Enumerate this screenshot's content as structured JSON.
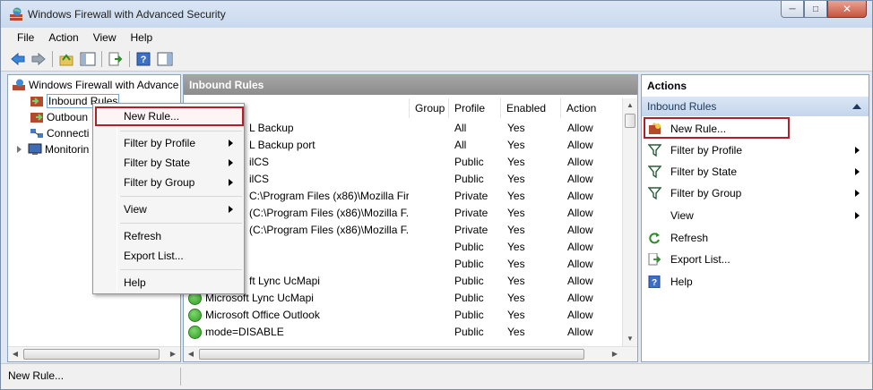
{
  "window": {
    "title": "Windows Firewall with Advanced Security"
  },
  "menubar": {
    "items": [
      "File",
      "Action",
      "View",
      "Help"
    ]
  },
  "tree": {
    "items": [
      {
        "label": "Windows Firewall with Advance",
        "icon": "firewall-icon"
      },
      {
        "label": "Inbound Rules",
        "icon": "inbound-rules-icon",
        "selected": true
      },
      {
        "label": "Outboun",
        "icon": "outbound-rules-icon"
      },
      {
        "label": "Connecti",
        "icon": "connection-security-icon"
      },
      {
        "label": "Monitorin",
        "icon": "monitoring-icon"
      }
    ]
  },
  "center": {
    "title": "Inbound Rules",
    "columns": [
      "Group",
      "Profile",
      "Enabled",
      "Action"
    ],
    "rows": [
      {
        "name": "L Backup",
        "group": "",
        "profile": "All",
        "enabled": "Yes",
        "action": "Allow",
        "icon": false
      },
      {
        "name": "L Backup port",
        "group": "",
        "profile": "All",
        "enabled": "Yes",
        "action": "Allow",
        "icon": false
      },
      {
        "name": "ilCS",
        "group": "",
        "profile": "Public",
        "enabled": "Yes",
        "action": "Allow",
        "icon": false
      },
      {
        "name": "ilCS",
        "group": "",
        "profile": "Public",
        "enabled": "Yes",
        "action": "Allow",
        "icon": false
      },
      {
        "name": "C:\\Program Files (x86)\\Mozilla Fir...",
        "group": "",
        "profile": "Private",
        "enabled": "Yes",
        "action": "Allow",
        "icon": false
      },
      {
        "name": "(C:\\Program Files (x86)\\Mozilla F...",
        "group": "",
        "profile": "Private",
        "enabled": "Yes",
        "action": "Allow",
        "icon": false
      },
      {
        "name": "(C:\\Program Files (x86)\\Mozilla F...",
        "group": "",
        "profile": "Private",
        "enabled": "Yes",
        "action": "Allow",
        "icon": false
      },
      {
        "name": "",
        "group": "",
        "profile": "Public",
        "enabled": "Yes",
        "action": "Allow",
        "icon": false
      },
      {
        "name": "",
        "group": "",
        "profile": "Public",
        "enabled": "Yes",
        "action": "Allow",
        "icon": false
      },
      {
        "name": "ft Lync UcMapi",
        "group": "",
        "profile": "Public",
        "enabled": "Yes",
        "action": "Allow",
        "icon": false
      },
      {
        "name": "Microsoft Lync UcMapi",
        "group": "",
        "profile": "Public",
        "enabled": "Yes",
        "action": "Allow",
        "icon": true
      },
      {
        "name": "Microsoft Office Outlook",
        "group": "",
        "profile": "Public",
        "enabled": "Yes",
        "action": "Allow",
        "icon": true
      },
      {
        "name": "mode=DISABLE",
        "group": "",
        "profile": "Public",
        "enabled": "Yes",
        "action": "Allow",
        "icon": true
      }
    ]
  },
  "actions": {
    "title": "Actions",
    "section": "Inbound Rules",
    "items": [
      {
        "label": "New Rule...",
        "icon": "new-rule-icon",
        "submenu": false
      },
      {
        "label": "Filter by Profile",
        "icon": "filter-icon",
        "submenu": true
      },
      {
        "label": "Filter by State",
        "icon": "filter-icon",
        "submenu": true
      },
      {
        "label": "Filter by Group",
        "icon": "filter-icon",
        "submenu": true
      },
      {
        "label": "View",
        "icon": "",
        "submenu": true
      },
      {
        "label": "Refresh",
        "icon": "refresh-icon",
        "submenu": false
      },
      {
        "label": "Export List...",
        "icon": "export-icon",
        "submenu": false
      },
      {
        "label": "Help",
        "icon": "help-icon",
        "submenu": false
      }
    ]
  },
  "context_menu": {
    "items": [
      {
        "label": "New Rule...",
        "submenu": false
      },
      {
        "label": "Filter by Profile",
        "submenu": true
      },
      {
        "label": "Filter by State",
        "submenu": true
      },
      {
        "label": "Filter by Group",
        "submenu": true
      },
      {
        "label": "View",
        "submenu": true
      },
      {
        "label": "Refresh",
        "submenu": false
      },
      {
        "label": "Export List...",
        "submenu": false
      },
      {
        "label": "Help",
        "submenu": false
      }
    ]
  },
  "status": {
    "text": "New Rule..."
  },
  "colors": {
    "highlight": "#b0202a",
    "accent": "#1e395b",
    "header": "#8c8c8c"
  }
}
